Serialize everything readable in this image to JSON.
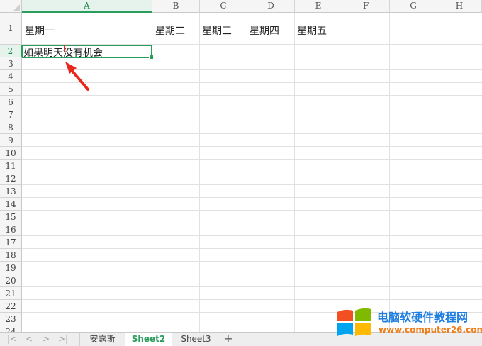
{
  "columns": [
    "A",
    "B",
    "C",
    "D",
    "E",
    "F",
    "G",
    "H"
  ],
  "active_column": "A",
  "rows": [
    "1",
    "2",
    "3",
    "4",
    "5",
    "6",
    "7",
    "8",
    "9",
    "10",
    "11",
    "12",
    "13",
    "14",
    "15",
    "16",
    "17",
    "18",
    "19",
    "20",
    "21",
    "22",
    "23",
    "24"
  ],
  "active_row": "2",
  "cells": {
    "A1": "星期一",
    "B1": "星期二",
    "C1": "星期三",
    "D1": "星期四",
    "E1": "星期五",
    "A2": "如果明天没有机会"
  },
  "selected_cell": "A2",
  "sheet_tabs": [
    {
      "label": "安嘉斯",
      "active": false
    },
    {
      "label": "Sheet2",
      "active": true
    },
    {
      "label": "Sheet3",
      "active": false
    }
  ],
  "tab_nav": [
    "|<",
    "<",
    ">",
    ">|"
  ],
  "add_tab_label": "+",
  "watermark": {
    "title": "电脑软硬件教程网",
    "url": "www.computer26.com"
  },
  "colors": {
    "accent": "#2a9d5c",
    "arrow": "#e8281c",
    "watermark_title": "#1e7de1",
    "watermark_url": "#ef7d1a"
  }
}
